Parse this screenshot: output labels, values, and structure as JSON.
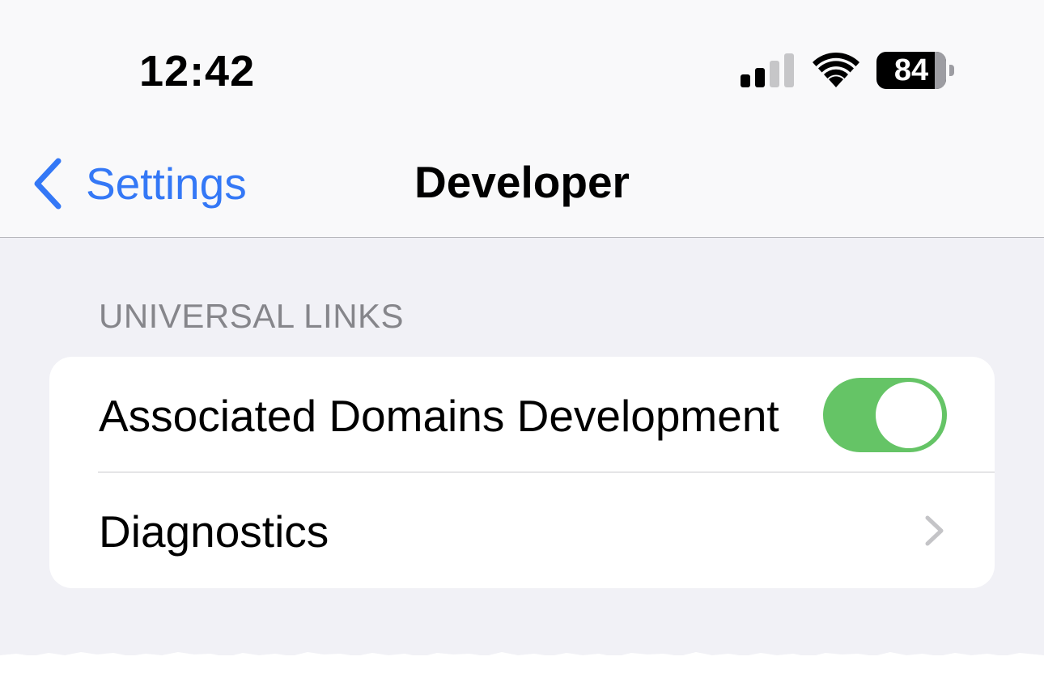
{
  "status_bar": {
    "time": "12:42",
    "signal_bars_total": 4,
    "signal_bars_active": 2,
    "battery_percent": "84",
    "battery_level": 0.84,
    "icons": [
      "cellular-signal-icon",
      "wifi-icon",
      "battery-icon"
    ]
  },
  "nav": {
    "back_label": "Settings",
    "back_icon": "chevron-left-icon",
    "title": "Developer"
  },
  "section": {
    "header": "UNIVERSAL LINKS",
    "rows": [
      {
        "label": "Associated Domains Development",
        "control": "toggle",
        "toggle_on": true
      },
      {
        "label": "Diagnostics",
        "control": "disclosure",
        "icon": "chevron-right-icon"
      }
    ]
  },
  "colors": {
    "accent": "#3478f6",
    "toggle_on": "#65c466",
    "background": "#f1f1f6",
    "section_header": "#86868b",
    "chevron": "#c4c4c7"
  }
}
